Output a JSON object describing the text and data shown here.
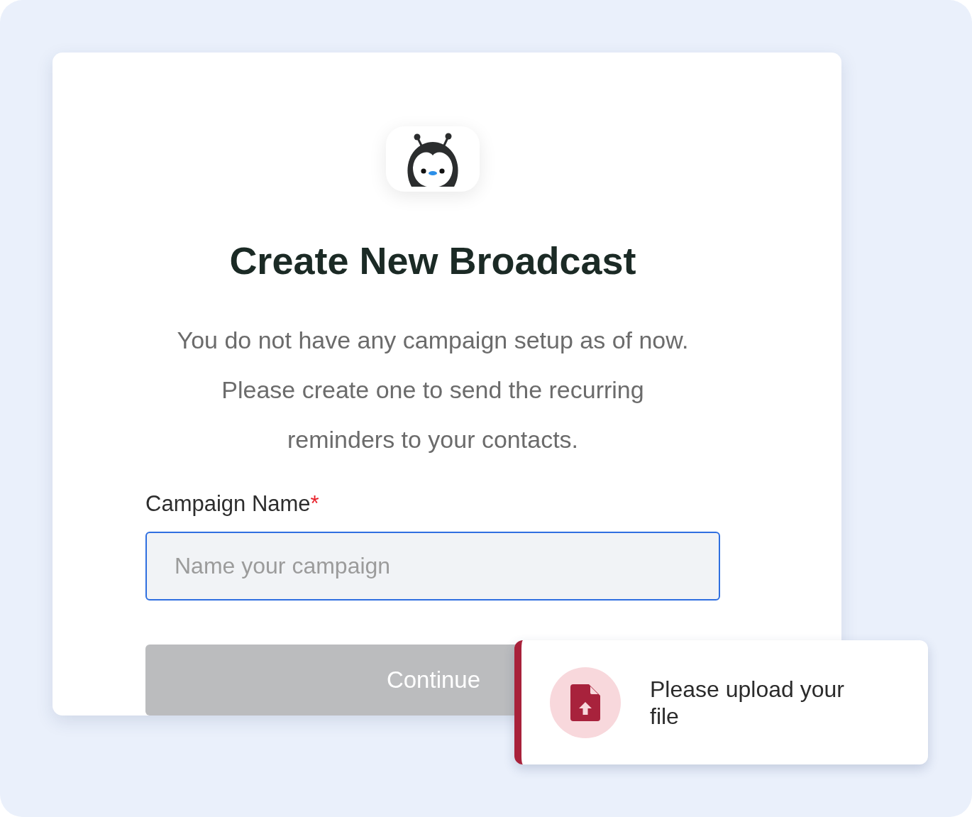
{
  "dialog": {
    "title": "Create New Broadcast",
    "description": "You do not have any campaign setup as of now. Please create one to send the recurring reminders to your contacts.",
    "field": {
      "label": "Campaign Name",
      "required_mark": "*",
      "placeholder": "Name your campaign",
      "focused": true
    },
    "continue_button": {
      "label": "Continue",
      "disabled": true
    }
  },
  "toast": {
    "message": "Please upload your file"
  }
}
